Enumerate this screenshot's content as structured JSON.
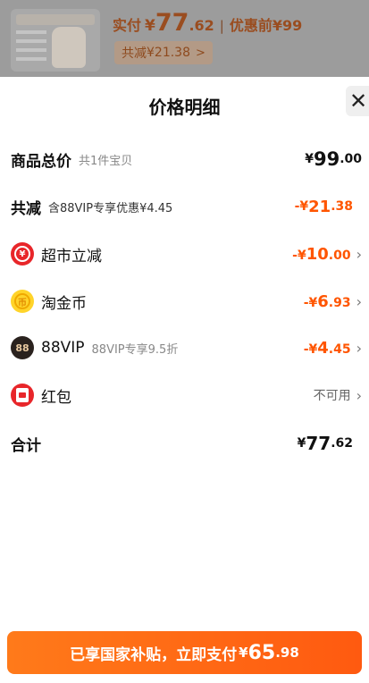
{
  "header": {
    "paid_label": "实付",
    "currency": "¥",
    "paid_int": "77",
    "paid_dec": ".62",
    "separator": "|",
    "before_label": "优惠前",
    "before_price": "¥99",
    "discount_label": "共减",
    "discount_value": "¥21.38",
    "discount_chevron": ">"
  },
  "sheet": {
    "title": "价格明细",
    "close_symbol": "✕"
  },
  "rows": {
    "total_goods": {
      "label": "商品总价",
      "sub": "共1件宝贝",
      "cur": "¥",
      "int": "99",
      "dec": ".00"
    },
    "total_discount": {
      "label": "共减",
      "sub": "含88VIP专享优惠¥4.45",
      "cur": "-¥",
      "int": "21",
      "dec": ".38"
    },
    "supermarket": {
      "icon_glyph": "¥",
      "label": "超市立减",
      "cur": "-¥",
      "int": "10",
      "dec": ".00",
      "chevron": "›"
    },
    "taojinbi": {
      "icon_glyph": "币",
      "label": "淘金币",
      "cur": "-¥",
      "int": "6",
      "dec": ".93",
      "chevron": "›"
    },
    "vip": {
      "icon_glyph": "88",
      "label": "88VIP",
      "sub": "88VIP专享9.5折",
      "cur": "-¥",
      "int": "4",
      "dec": ".45",
      "chevron": "›"
    },
    "hongbao": {
      "label": "红包",
      "status": "不可用",
      "chevron": "›"
    },
    "sum": {
      "label": "合计",
      "cur": "¥",
      "int": "77",
      "dec": ".62"
    }
  },
  "cta": {
    "label": "已享国家补贴，立即支付",
    "cur": "¥",
    "int": "65",
    "dec": ".98"
  },
  "colors": {
    "accent": "#ff5500",
    "cta_start": "#ff7a1a",
    "cta_end": "#ff5a10"
  },
  "icons": {
    "supermarket": "yen-coin-icon",
    "taojinbi": "gold-coin-icon",
    "vip": "vip-badge-icon",
    "hongbao": "red-envelope-icon",
    "close": "close-icon",
    "chevron": "chevron-right-icon"
  }
}
